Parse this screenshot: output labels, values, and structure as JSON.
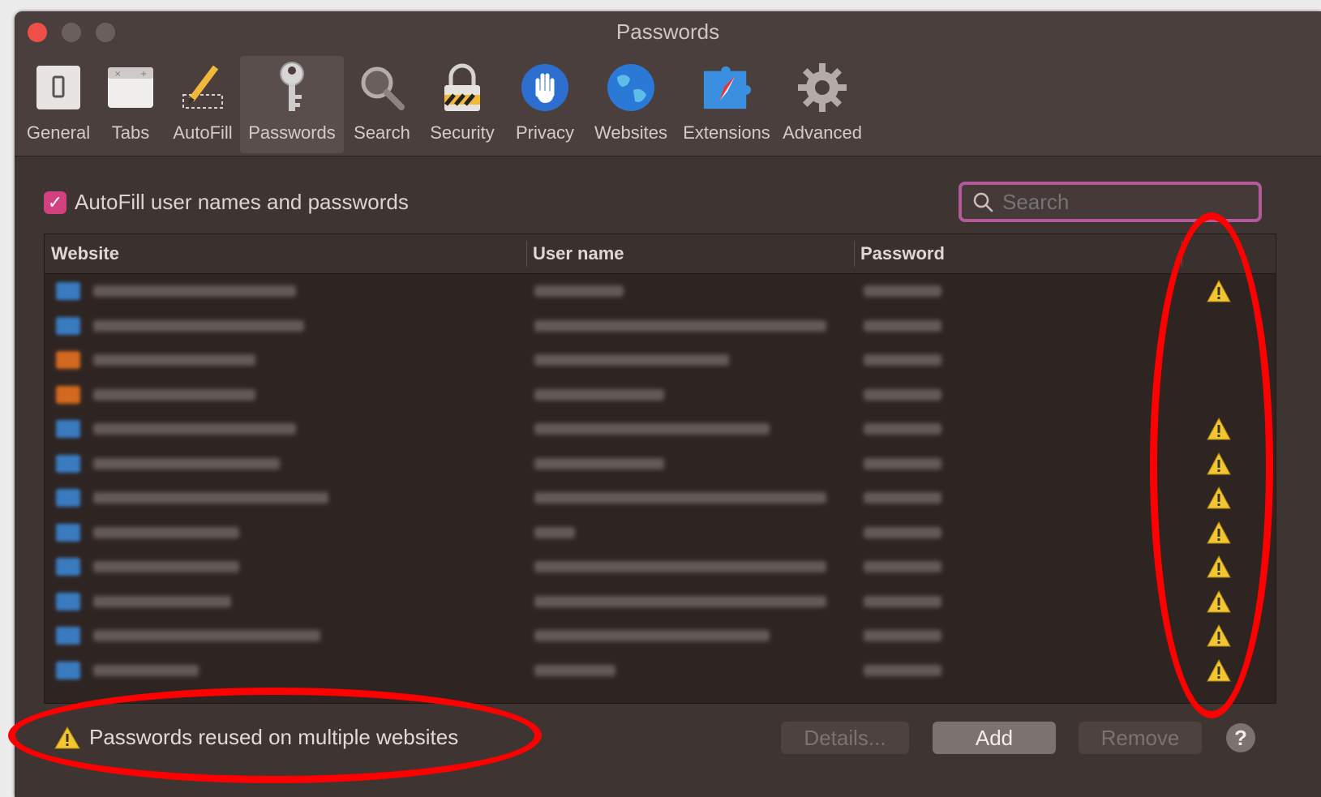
{
  "window": {
    "title": "Passwords"
  },
  "toolbar": {
    "items": [
      {
        "label": "General",
        "icon": "general-switch-icon",
        "selected": false
      },
      {
        "label": "Tabs",
        "icon": "tabs-icon",
        "selected": false
      },
      {
        "label": "AutoFill",
        "icon": "autofill-pencil-icon",
        "selected": false
      },
      {
        "label": "Passwords",
        "icon": "key-icon",
        "selected": true
      },
      {
        "label": "Search",
        "icon": "magnifier-icon",
        "selected": false
      },
      {
        "label": "Security",
        "icon": "padlock-icon",
        "selected": false
      },
      {
        "label": "Privacy",
        "icon": "hand-icon",
        "selected": false
      },
      {
        "label": "Websites",
        "icon": "globe-icon",
        "selected": false
      },
      {
        "label": "Extensions",
        "icon": "puzzle-compass-icon",
        "selected": false
      },
      {
        "label": "Advanced",
        "icon": "gear-icon",
        "selected": false
      }
    ]
  },
  "autofill": {
    "label": "AutoFill user names and passwords",
    "checked": true
  },
  "search": {
    "placeholder": "Search"
  },
  "table": {
    "columns": [
      "Website",
      "User name",
      "Password"
    ],
    "rows": [
      {
        "warning": true
      },
      {
        "warning": false
      },
      {
        "warning": false
      },
      {
        "warning": false
      },
      {
        "warning": true
      },
      {
        "warning": true
      },
      {
        "warning": true
      },
      {
        "warning": true
      },
      {
        "warning": true
      },
      {
        "warning": true
      },
      {
        "warning": true
      },
      {
        "warning": true
      }
    ]
  },
  "footer": {
    "reuse_warning": "Passwords reused on multiple websites",
    "details_label": "Details...",
    "add_label": "Add",
    "remove_label": "Remove",
    "help_label": "?"
  },
  "colors": {
    "accent": "#d2407f",
    "warning": "#f2c531",
    "annotation": "#ff0000"
  }
}
